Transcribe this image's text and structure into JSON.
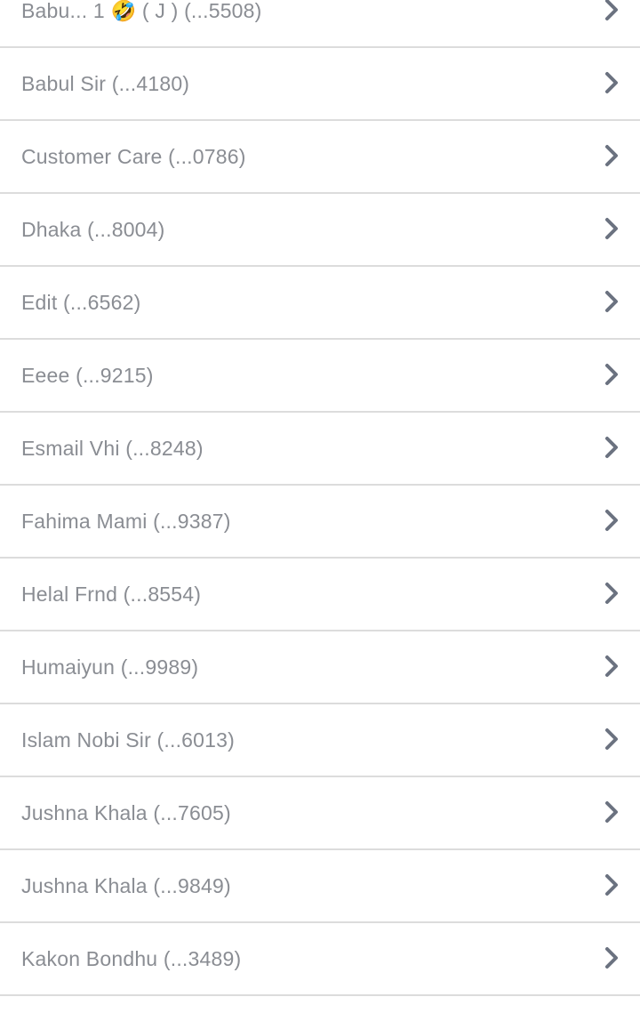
{
  "contacts": {
    "items": [
      {
        "label": "Babu... 1 🤣 ( J ) (...5508)"
      },
      {
        "label": "Babul Sir (...4180)"
      },
      {
        "label": "Customer Care (...0786)"
      },
      {
        "label": "Dhaka (...8004)"
      },
      {
        "label": "Edit (...6562)"
      },
      {
        "label": "Eeee (...9215)"
      },
      {
        "label": "Esmail Vhi (...8248)"
      },
      {
        "label": "Fahima Mami (...9387)"
      },
      {
        "label": "Helal Frnd (...8554)"
      },
      {
        "label": "Humaiyun (...9989)"
      },
      {
        "label": "Islam Nobi Sir (...6013)"
      },
      {
        "label": "Jushna Khala (...7605)"
      },
      {
        "label": "Jushna Khala (...9849)"
      },
      {
        "label": "Kakon Bondhu (...3489)"
      }
    ],
    "chevron_icon": "chevron-right-icon",
    "colors": {
      "text": "#8a8d93",
      "chevron": "#6b7280",
      "divider": "#dcdcdc",
      "background": "#ffffff"
    }
  }
}
